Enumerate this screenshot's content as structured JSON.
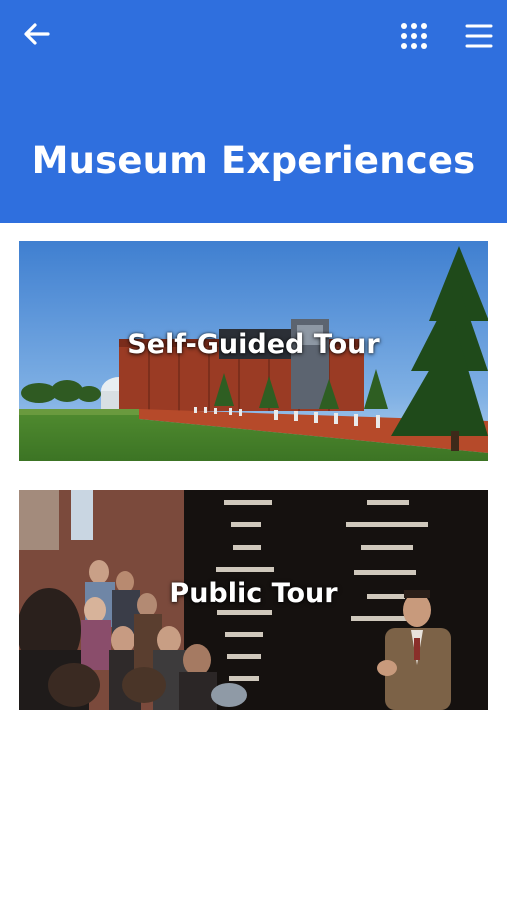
{
  "header": {
    "title": "Museum Experiences",
    "background_color": "#2f6fde",
    "back_icon": "back-arrow-icon",
    "grid_icon": "grid-dots-icon",
    "menu_icon": "hamburger-menu-icon"
  },
  "cards": [
    {
      "label": "Self-Guided Tour",
      "image": "memorial-center-building"
    },
    {
      "label": "Public Tour",
      "image": "guide-with-visitors-at-memorial-wall"
    }
  ]
}
